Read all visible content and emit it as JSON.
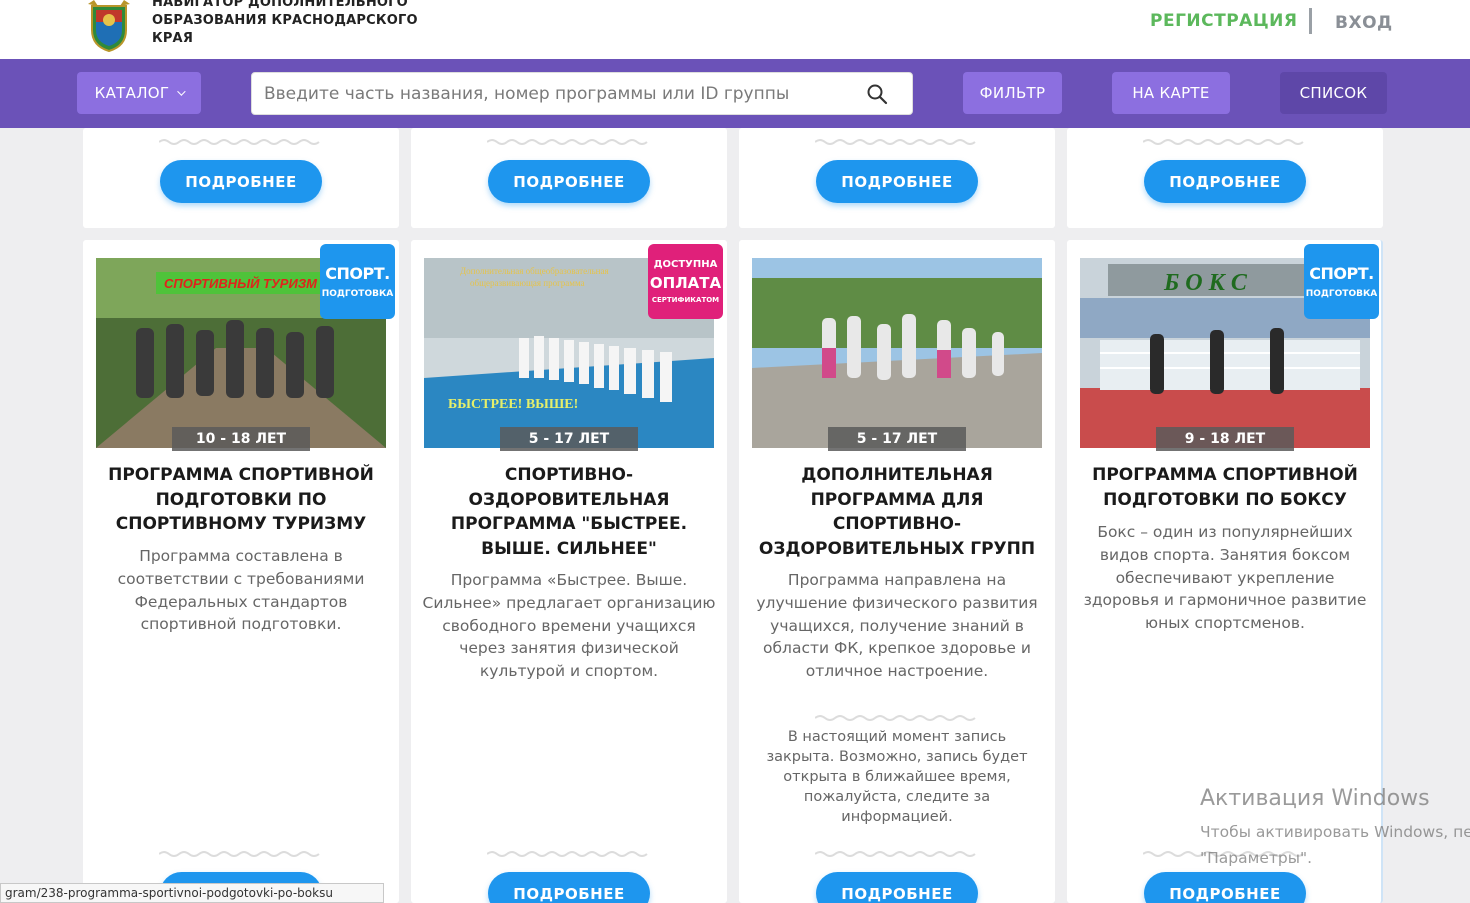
{
  "header": {
    "title": "Навигатор дополнительного образования Краснодарского края",
    "register": "РЕГИСТРАЦИЯ",
    "login": "ВХОД"
  },
  "navbar": {
    "catalog": "КАТАЛОГ",
    "search_placeholder": "Введите часть названия, номер программы или ID группы",
    "filter": "ФИЛЬТР",
    "map": "НА КАРТЕ",
    "list": "СПИСОК"
  },
  "more_label": "ПОДРОБНЕЕ",
  "cards": [
    {
      "age": "10 - 18 ЛЕТ",
      "badge_main": "СПОРТ.",
      "badge_sub": "ПОДГОТОВКА",
      "photo_caption": "СПОРТИВНЫЙ ТУРИЗМ",
      "title": "Программа спортивной подготовки по спортивному туризму",
      "desc": "Программа составлена в соответствии с требованиями Федеральных стандартов спортивной подготовки."
    },
    {
      "age": "5 - 17 ЛЕТ",
      "badge_top": "ДОСТУПНА",
      "badge_main": "ОПЛАТА",
      "badge_sub": "СЕРТИФИКАТОМ",
      "photo_caption_1": "Дополнительная общеобразовательная",
      "photo_caption_2": "общеразвивающая программа",
      "photo_caption_3": "БЫСТРЕЕ! ВЫШЕ!",
      "title": "Спортивно-оздоровительная программа \"Быстрее. Выше. Сильнее\"",
      "desc": "Программа «Быстрее. Выше. Сильнее» предлагает организацию свободного времени учащихся через занятия физической культурой и спортом."
    },
    {
      "age": "5 - 17 ЛЕТ",
      "title": "Дополнительная программа для спортивно-оздоровительных групп",
      "desc": "Программа направлена на улучшение физического развития учащихся, получение знаний в области ФК, крепкое здоровье и отличное настроение.",
      "closed": "В настоящий момент запись закрыта. Возможно, запись будет открыта в ближайшее время, пожалуйста, следите за информацией."
    },
    {
      "age": "9 - 18 ЛЕТ",
      "badge_main": "СПОРТ.",
      "badge_sub": "ПОДГОТОВКА",
      "photo_caption": "Б О К С",
      "title": "Программа спортивной подготовки по боксу",
      "desc": "Бокс – один из популярнейших видов спорта. Занятия боксом обеспечивают укрепление здоровья и гармоничное развитие юных спортсменов."
    }
  ],
  "status_url": "gram/238-programma-sportivnoi-podgotovki-po-boksu",
  "windows": {
    "title": "Активация Windows",
    "sub1": "Чтобы активировать Windows, пе",
    "sub2": "\"Параметры\"."
  },
  "colors": {
    "brand_purple": "#6b52b8",
    "button_purple": "#8c6fe0",
    "more_blue": "#1e96ee",
    "register_green": "#5cb85c",
    "pay_pink": "#e0207a"
  }
}
